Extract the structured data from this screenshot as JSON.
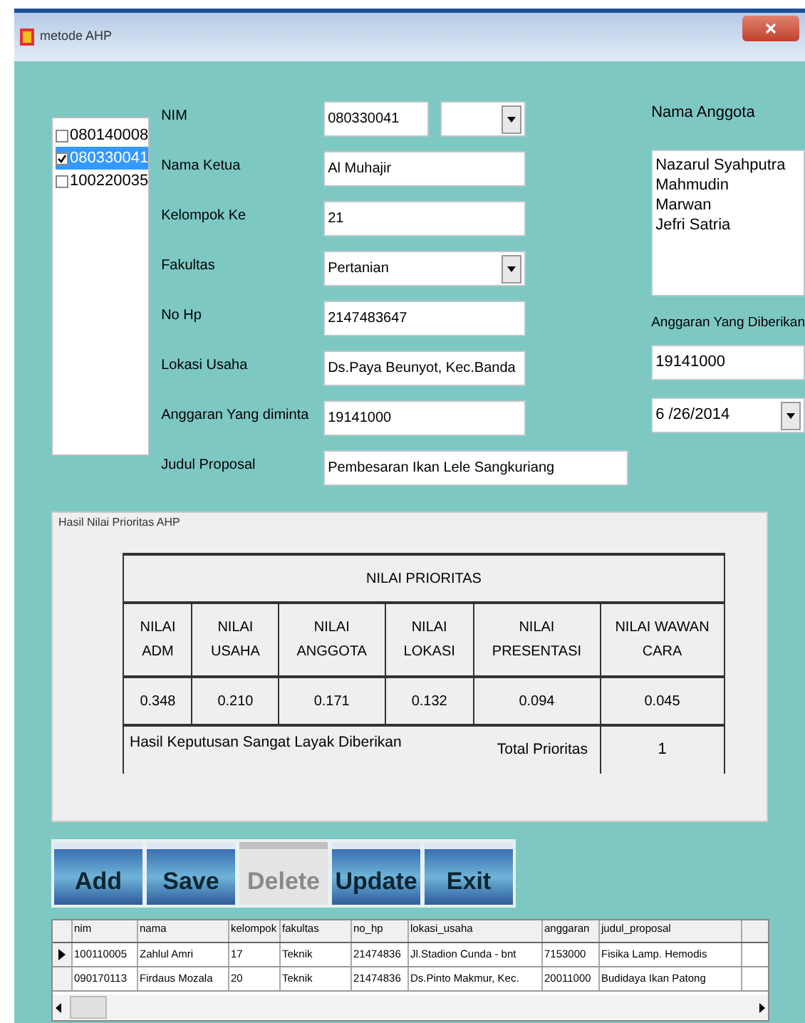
{
  "window": {
    "title": "metode AHP"
  },
  "nim_list": [
    {
      "label": "080140008",
      "checked": false,
      "selected": false
    },
    {
      "label": "080330041",
      "checked": true,
      "selected": true
    },
    {
      "label": "100220035",
      "checked": false,
      "selected": false
    }
  ],
  "fields": [
    {
      "label": "NIM",
      "value": "080330041",
      "kind": "nim"
    },
    {
      "label": "Nama Ketua",
      "value": "Al Muhajir",
      "kind": "text"
    },
    {
      "label": "Kelompok Ke",
      "value": "21",
      "kind": "text"
    },
    {
      "label": "Fakultas",
      "value": "Pertanian",
      "kind": "combo"
    },
    {
      "label": "No Hp",
      "value": "2147483647",
      "kind": "text"
    },
    {
      "label": "Lokasi Usaha",
      "value": "Ds.Paya Beunyot, Kec.Banda",
      "kind": "text"
    },
    {
      "label": "Anggaran Yang diminta",
      "value": "19141000",
      "kind": "text"
    },
    {
      "label": "Judul Proposal",
      "value": "Pembesaran Ikan Lele Sangkuriang",
      "kind": "wide"
    }
  ],
  "members": {
    "label": "Nama Anggota",
    "lines": [
      "Nazarul Syahputra",
      "Mahmudin",
      "Marwan",
      "Jefri Satria"
    ]
  },
  "budget_given": {
    "label": "Anggaran Yang Diberikan",
    "value": "19141000"
  },
  "date": {
    "value": "6 /26/2014"
  },
  "result": {
    "legend": "Hasil Nilai Prioritas AHP",
    "title": "NILAI PRIORITAS",
    "columns": [
      "NILAI ADM",
      "NILAI USAHA",
      "NILAI ANGGOTA",
      "NILAI LOKASI",
      "NILAI PRESENTASI",
      "NILAI WAWAN CARA"
    ],
    "values": [
      "0.348",
      "0.210",
      "0.171",
      "0.132",
      "0.094",
      "0.045"
    ],
    "decision": "Hasil Keputusan  Sangat Layak Diberikan",
    "total_label": "Total Prioritas",
    "total": "1"
  },
  "buttons": [
    {
      "label": "Add",
      "disabled": false
    },
    {
      "label": "Save",
      "disabled": false
    },
    {
      "label": "Delete",
      "disabled": true
    },
    {
      "label": "Update",
      "disabled": false
    },
    {
      "label": "Exit",
      "disabled": false
    }
  ],
  "grid": {
    "columns": [
      "nim",
      "nama",
      "kelompok",
      "fakultas",
      "no_hp",
      "lokasi_usaha",
      "anggaran",
      "judul_proposal"
    ],
    "rows": [
      {
        "selected": true,
        "cells": [
          "100110005",
          "Zahlul Amri",
          "17",
          "Teknik",
          "21474836",
          "Jl.Stadion Cunda - bnt",
          "7153000",
          "Fisika Lamp. Hemodis"
        ]
      },
      {
        "selected": false,
        "cells": [
          "090170113",
          "Firdaus Mozala",
          "20",
          "Teknik",
          "21474836",
          "Ds.Pinto Makmur, Kec.",
          "20011000",
          "Budidaya Ikan Patong"
        ]
      }
    ]
  }
}
